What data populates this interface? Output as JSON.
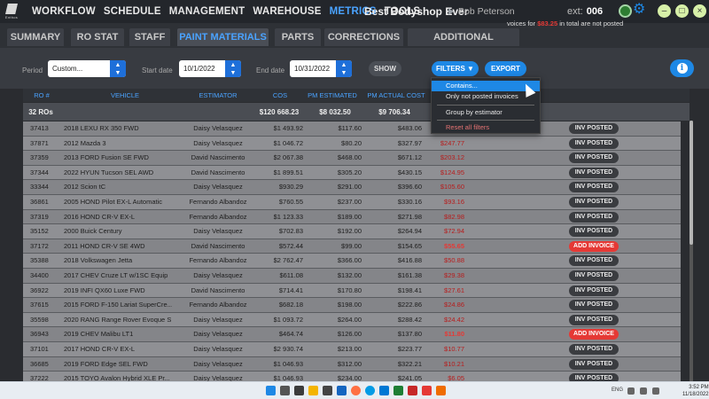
{
  "app": {
    "brand": "Enthos",
    "nav": [
      "WORKFLOW",
      "SCHEDULE",
      "MANAGEMENT",
      "WAREHOUSE",
      "METRICS",
      "TOOLS"
    ],
    "active_nav": "METRICS",
    "shop_name": "Best Bodyshop Ever",
    "user_name": "Bob Peterson",
    "ext_label": "ext:",
    "ext_value": "006"
  },
  "tabs": [
    "SUMMARY",
    "RO STAT",
    "STAFF",
    "PAINT MATERIALS",
    "PARTS",
    "CORRECTIONS",
    "ADDITIONAL SERVICES"
  ],
  "active_tab": "PAINT MATERIALS",
  "filters": {
    "period_label": "Period",
    "period_value": "Custom...",
    "start_label": "Start date",
    "start_value": "10/1/2022",
    "end_label": "End date",
    "end_value": "10/31/2022",
    "show_label": "SHOW",
    "filters_label": "FILTERS ▼",
    "export_label": "EXPORT"
  },
  "menu": {
    "items": [
      "Contains...",
      "Only not posted invoices",
      "Group by estimator",
      "Reset all filters"
    ],
    "highlighted": "Contains..."
  },
  "table": {
    "headers": [
      "RO #",
      "VEHICLE",
      "ESTIMATOR",
      "COS",
      "PM ESTIMATED",
      "PM ACTUAL COST"
    ],
    "totals": {
      "count": "32 ROs",
      "cos": "$120 668.23",
      "pm_estimated": "$8 032.50",
      "pm_actual": "$9 706.34"
    },
    "notice_prefix": "voices for ",
    "notice_amount": "$83.25",
    "notice_suffix": " in total are not posted",
    "rows": [
      {
        "ro": "37413",
        "vehicle": "2018 LEXU RX 350 FWD",
        "estimator": "Daisy Velasquez",
        "cos": "$1 493.92",
        "pm_est": "$117.60",
        "pm_act": "$483.06",
        "diff": "",
        "status": "INV POSTED"
      },
      {
        "ro": "37871",
        "vehicle": "2012 Mazda 3",
        "estimator": "Daisy Velasquez",
        "cos": "$1 046.72",
        "pm_est": "$80.20",
        "pm_act": "$327.97",
        "diff": "$247.77",
        "status": "INV POSTED"
      },
      {
        "ro": "37359",
        "vehicle": "2013 FORD Fusion SE FWD",
        "estimator": "David Nascimento",
        "cos": "$2 067.38",
        "pm_est": "$468.00",
        "pm_act": "$671.12",
        "diff": "$203.12",
        "status": "INV POSTED"
      },
      {
        "ro": "37344",
        "vehicle": "2022 HYUN Tucson SEL AWD",
        "estimator": "David Nascimento",
        "cos": "$1 899.51",
        "pm_est": "$305.20",
        "pm_act": "$430.15",
        "diff": "$124.95",
        "status": "INV POSTED"
      },
      {
        "ro": "33344",
        "vehicle": "2012 Scion tC",
        "estimator": "Daisy Velasquez",
        "cos": "$930.29",
        "pm_est": "$291.00",
        "pm_act": "$396.60",
        "diff": "$105.60",
        "status": "INV POSTED"
      },
      {
        "ro": "36861",
        "vehicle": "2005 HOND Pilot EX-L Automatic",
        "estimator": "Fernando Albandoz",
        "cos": "$760.55",
        "pm_est": "$237.00",
        "pm_act": "$330.16",
        "diff": "$93.16",
        "status": "INV POSTED"
      },
      {
        "ro": "37319",
        "vehicle": "2016 HOND CR-V EX-L",
        "estimator": "Fernando Albandoz",
        "cos": "$1 123.33",
        "pm_est": "$189.00",
        "pm_act": "$271.98",
        "diff": "$82.98",
        "status": "INV POSTED"
      },
      {
        "ro": "35152",
        "vehicle": "2000 Buick Century",
        "estimator": "Daisy Velasquez",
        "cos": "$702.83",
        "pm_est": "$192.00",
        "pm_act": "$264.94",
        "diff": "$72.94",
        "status": "INV POSTED"
      },
      {
        "ro": "37172",
        "vehicle": "2011 HOND CR-V SE 4WD",
        "estimator": "David Nascimento",
        "cos": "$572.44",
        "pm_est": "$99.00",
        "pm_act": "$154.65",
        "diff": "$55.65",
        "status": "ADD INVOICE"
      },
      {
        "ro": "35388",
        "vehicle": "2018 Volkswagen Jetta",
        "estimator": "Fernando Albandoz",
        "cos": "$2 762.47",
        "pm_est": "$366.00",
        "pm_act": "$416.88",
        "diff": "$50.88",
        "status": "INV POSTED"
      },
      {
        "ro": "34400",
        "vehicle": "2017 CHEV Cruze LT w/1SC Equip",
        "estimator": "Daisy Velasquez",
        "cos": "$611.08",
        "pm_est": "$132.00",
        "pm_act": "$161.38",
        "diff": "$29.38",
        "status": "INV POSTED"
      },
      {
        "ro": "36922",
        "vehicle": "2019 INFI QX60 Luxe FWD",
        "estimator": "David Nascimento",
        "cos": "$714.41",
        "pm_est": "$170.80",
        "pm_act": "$198.41",
        "diff": "$27.61",
        "status": "INV POSTED"
      },
      {
        "ro": "37615",
        "vehicle": "2015 FORD F-150 Lariat SuperCre...",
        "estimator": "Fernando Albandoz",
        "cos": "$682.18",
        "pm_est": "$198.00",
        "pm_act": "$222.86",
        "diff": "$24.86",
        "status": "INV POSTED"
      },
      {
        "ro": "35598",
        "vehicle": "2020 RANG Range Rover Evoque S...",
        "estimator": "Daisy Velasquez",
        "cos": "$1 093.72",
        "pm_est": "$264.00",
        "pm_act": "$288.42",
        "diff": "$24.42",
        "status": "INV POSTED"
      },
      {
        "ro": "36943",
        "vehicle": "2019 CHEV Malibu LT1",
        "estimator": "Daisy Velasquez",
        "cos": "$464.74",
        "pm_est": "$126.00",
        "pm_act": "$137.80",
        "diff": "$11.80",
        "status": "ADD INVOICE"
      },
      {
        "ro": "37101",
        "vehicle": "2017 HOND CR-V EX-L",
        "estimator": "Daisy Velasquez",
        "cos": "$2 930.74",
        "pm_est": "$213.00",
        "pm_act": "$223.77",
        "diff": "$10.77",
        "status": "INV POSTED"
      },
      {
        "ro": "36685",
        "vehicle": "2019 FORD Edge SEL FWD",
        "estimator": "Daisy Velasquez",
        "cos": "$1 046.93",
        "pm_est": "$312.00",
        "pm_act": "$322.21",
        "diff": "$10.21",
        "status": "INV POSTED"
      },
      {
        "ro": "37222",
        "vehicle": "2015 TOYO Avalon Hybrid XLE Pr...",
        "estimator": "Daisy Velasquez",
        "cos": "$1 046.93",
        "pm_est": "$234.00",
        "pm_act": "$241.05",
        "diff": "$6.05",
        "status": "INV POSTED"
      }
    ]
  },
  "taskbar": {
    "lang": "ENG",
    "time": "3:52 PM",
    "date": "11/18/2022"
  }
}
